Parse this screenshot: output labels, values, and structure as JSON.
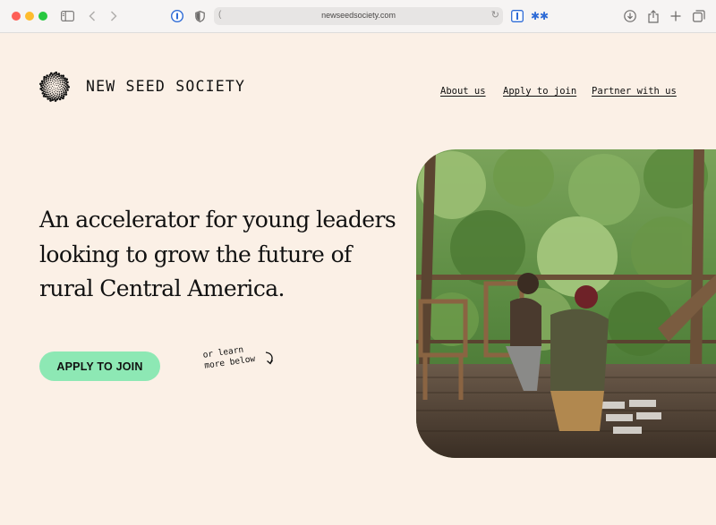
{
  "browser": {
    "url": "newseedsociety.com",
    "icons": [
      "sidebar-icon",
      "back-icon",
      "forward-icon",
      "password-manager-icon",
      "shield-icon",
      "reload-icon",
      "extension-icon",
      "bluetooth-icon",
      "download-icon",
      "share-icon",
      "new-tab-icon",
      "tabs-overview-icon"
    ]
  },
  "site": {
    "brand": "NEW SEED SOCIETY",
    "nav": [
      "About us",
      "Apply to join",
      "Partner with us"
    ],
    "headline": {
      "line1": "An accelerator for young leaders",
      "line2": "looking to grow the future of",
      "line3": "rural Central America."
    },
    "cta_label": "APPLY TO JOIN",
    "learn_more": {
      "line1": "or learn",
      "line2": "more below"
    }
  },
  "colors": {
    "page_bg": "#fbf0e6",
    "cta_bg": "#8de8b4",
    "text": "#111111"
  }
}
